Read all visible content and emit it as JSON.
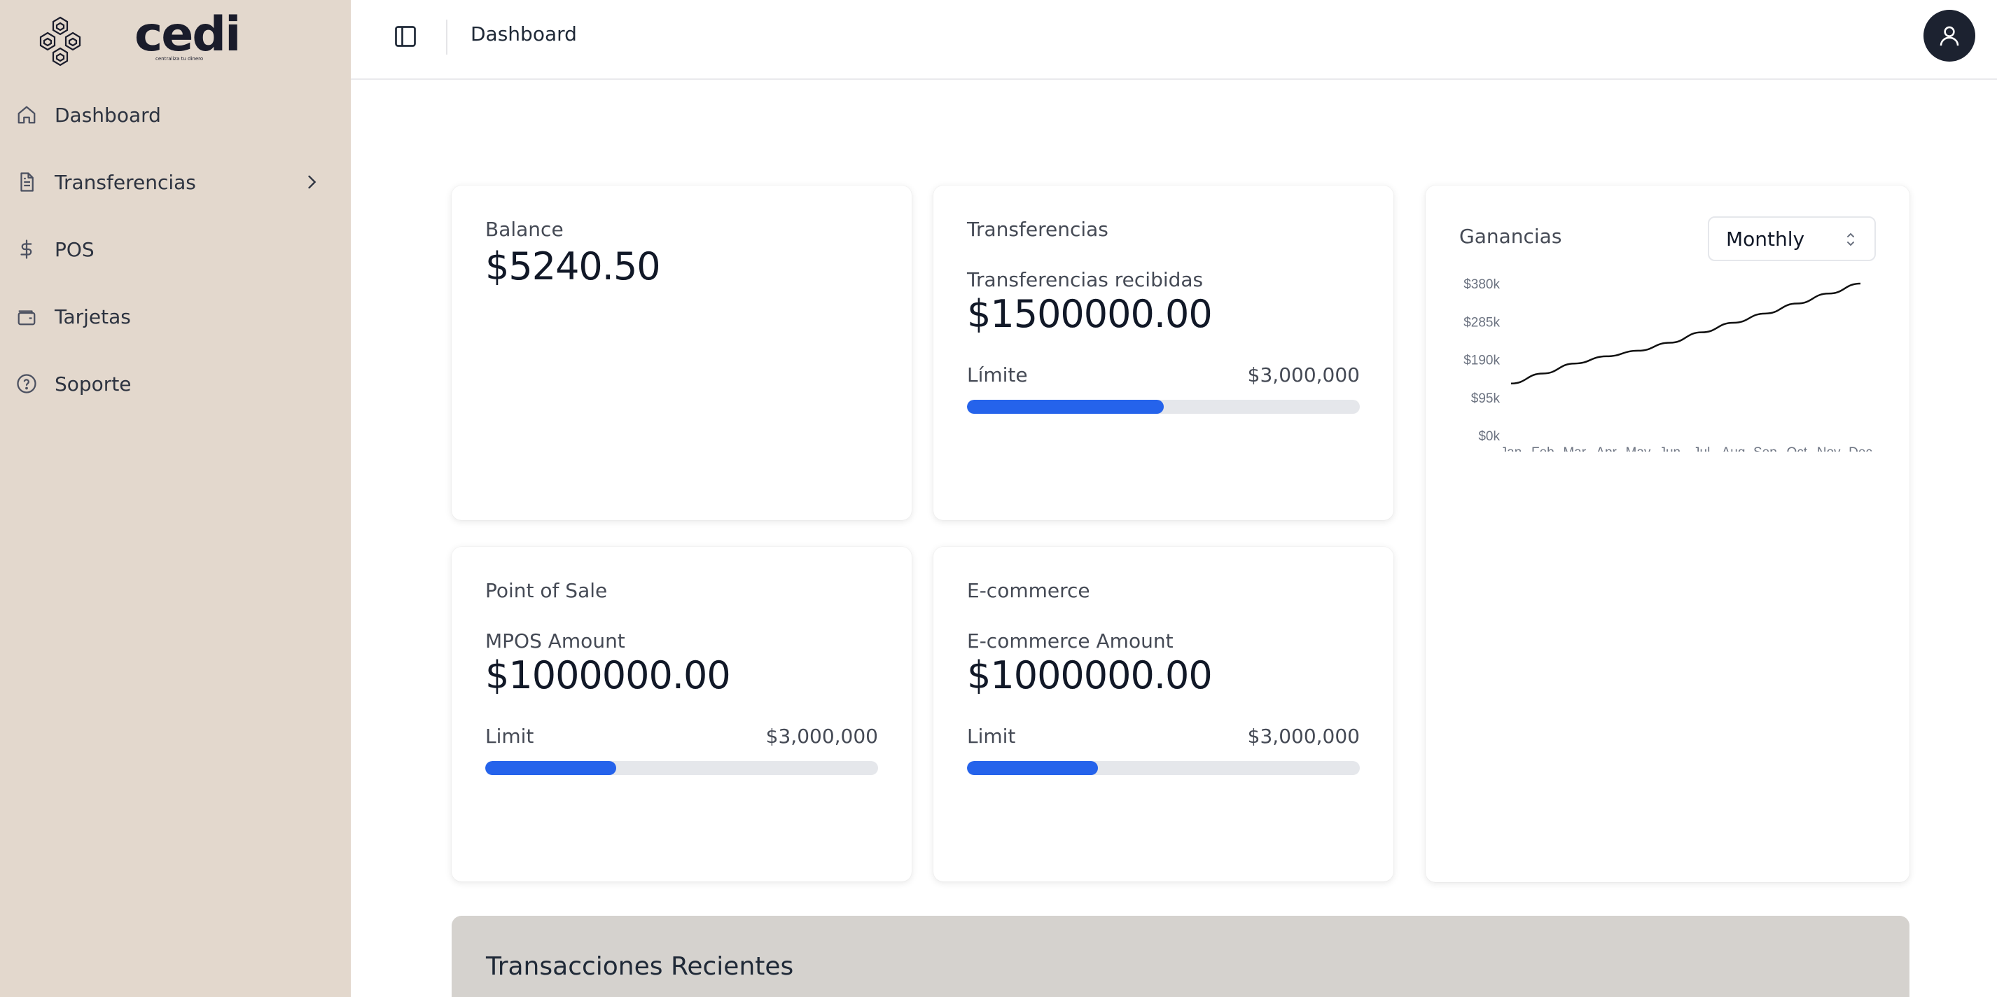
{
  "brand": {
    "name": "cedi",
    "tagline": "centraliza tu dinero"
  },
  "sidebar": {
    "items": [
      {
        "label": "Dashboard",
        "icon": "home-icon"
      },
      {
        "label": "Transferencias",
        "icon": "document-icon",
        "has_children": true
      },
      {
        "label": "POS",
        "icon": "dollar-icon"
      },
      {
        "label": "Tarjetas",
        "icon": "wallet-icon"
      },
      {
        "label": "Soporte",
        "icon": "help-circle-icon"
      }
    ]
  },
  "header": {
    "title": "Dashboard"
  },
  "colors": {
    "sidebar_bg": "#e3d8cd",
    "accent": "#2563eb",
    "avatar_bg": "#1c2230",
    "recent_bg": "#d5d2ce"
  },
  "cards": {
    "balance": {
      "title": "Balance",
      "amount": "$5240.50"
    },
    "transfers": {
      "title": "Transferencias",
      "subtitle": "Transferencias recibidas",
      "amount": "$1500000.00",
      "limit_label": "Límite",
      "limit_value": "$3,000,000",
      "progress": 0.5
    },
    "pos": {
      "title": "Point of Sale",
      "subtitle": "MPOS Amount",
      "amount": "$1000000.00",
      "limit_label": "Limit",
      "limit_value": "$3,000,000",
      "progress": 0.3333
    },
    "ecommerce": {
      "title": "E-commerce",
      "subtitle": "E-commerce Amount",
      "amount": "$1000000.00",
      "limit_label": "Limit",
      "limit_value": "$3,000,000",
      "progress": 0.3333
    },
    "earnings": {
      "title": "Ganancias",
      "period": "Monthly"
    }
  },
  "chart_data": {
    "type": "line",
    "categories": [
      "Jan",
      "Feb",
      "Mar",
      "Apr",
      "May",
      "Jun",
      "Jul",
      "Aug",
      "Sep",
      "Oct",
      "Nov",
      "Dec"
    ],
    "series": [
      {
        "values": [
          130,
          155,
          180,
          198,
          212,
          232,
          258,
          282,
          305,
          330,
          355,
          380
        ]
      }
    ],
    "y_ticks": [
      "$0k",
      "$95k",
      "$190k",
      "$285k",
      "$380k"
    ],
    "ylim": [
      0,
      380
    ],
    "grid": false,
    "legend": "none"
  },
  "recent": {
    "title": "Transacciones Recientes"
  }
}
